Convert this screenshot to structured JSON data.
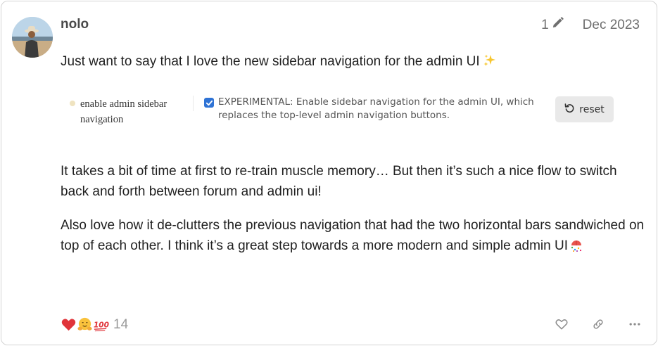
{
  "post": {
    "username": "nolo",
    "edit_count": "1",
    "date": "Dec 2023",
    "paragraph1": "Just want to say that I love the new sidebar navigation for the admin UI",
    "paragraph2": "It takes a bit of time at first to re-train muscle memory… But then it’s such a nice flow to switch back and forth between forum and admin ui!",
    "paragraph3": "Also love how it de-clutters the previous navigation that had the two horizontal bars sandwiched on top of each other. I think it’s a great step towards a more modern and simple admin UI"
  },
  "setting": {
    "name": "enable admin sidebar navigation",
    "checked": true,
    "description": "EXPERIMENTAL: Enable sidebar navigation for the admin UI, which replaces the top-level admin navigation buttons.",
    "reset_label": "reset"
  },
  "reactions": {
    "icons": [
      "heart",
      "hugs",
      "100"
    ],
    "count": "14"
  },
  "actions": [
    "like-icon",
    "link-icon",
    "more-icon"
  ],
  "colors": {
    "checkbox": "#2f73d5",
    "heart": "#e0343a",
    "reset_bg": "#e9e9e9"
  }
}
